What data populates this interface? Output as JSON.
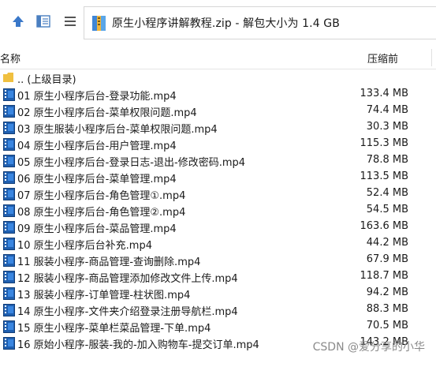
{
  "toolbar": {
    "address": "原生小程序讲解教程.zip - 解包大小为 1.4 GB"
  },
  "columns": {
    "name": "名称",
    "size": "压缩前"
  },
  "parent": {
    "label": ".. (上级目录)"
  },
  "files": [
    {
      "name": "01 原生小程序后台-登录功能.mp4",
      "size": "133.4 MB"
    },
    {
      "name": "02  原生小程序后台-菜单权限问题.mp4",
      "size": "74.4 MB"
    },
    {
      "name": "03  原生服装小程序后台-菜单权限问题.mp4",
      "size": "30.3 MB"
    },
    {
      "name": "04  原生小程序后台-用户管理.mp4",
      "size": "115.3 MB"
    },
    {
      "name": "05  原生小程序后台-登录日志-退出-修改密码.mp4",
      "size": "78.8 MB"
    },
    {
      "name": "06  原生小程序后台-菜单管理.mp4",
      "size": "113.5 MB"
    },
    {
      "name": "07  原生小程序后台-角色管理①.mp4",
      "size": "52.4 MB"
    },
    {
      "name": "08  原生小程序后台-角色管理②.mp4",
      "size": "54.5 MB"
    },
    {
      "name": "09  原生小程序后台-菜品管理.mp4",
      "size": "163.6 MB"
    },
    {
      "name": "10  原生小程序后台补充.mp4",
      "size": "44.2 MB"
    },
    {
      "name": "11 服装小程序-商品管理-查询删除.mp4",
      "size": "67.9 MB"
    },
    {
      "name": "12 服装小程序-商品管理添加修改文件上传.mp4",
      "size": "118.7 MB"
    },
    {
      "name": "13 服装小程序-订单管理-柱状图.mp4",
      "size": "94.2 MB"
    },
    {
      "name": "14  原生小程序-文件夹介绍登录注册导航栏.mp4",
      "size": "88.3 MB"
    },
    {
      "name": "15 原生小程序-菜单栏菜品管理-下单.mp4",
      "size": "70.5 MB"
    },
    {
      "name": "16 原始小程序-服装-我的-加入购物车-提交订单.mp4",
      "size": "143.2 MB"
    }
  ],
  "watermark": "CSDN @爱分享的小华"
}
